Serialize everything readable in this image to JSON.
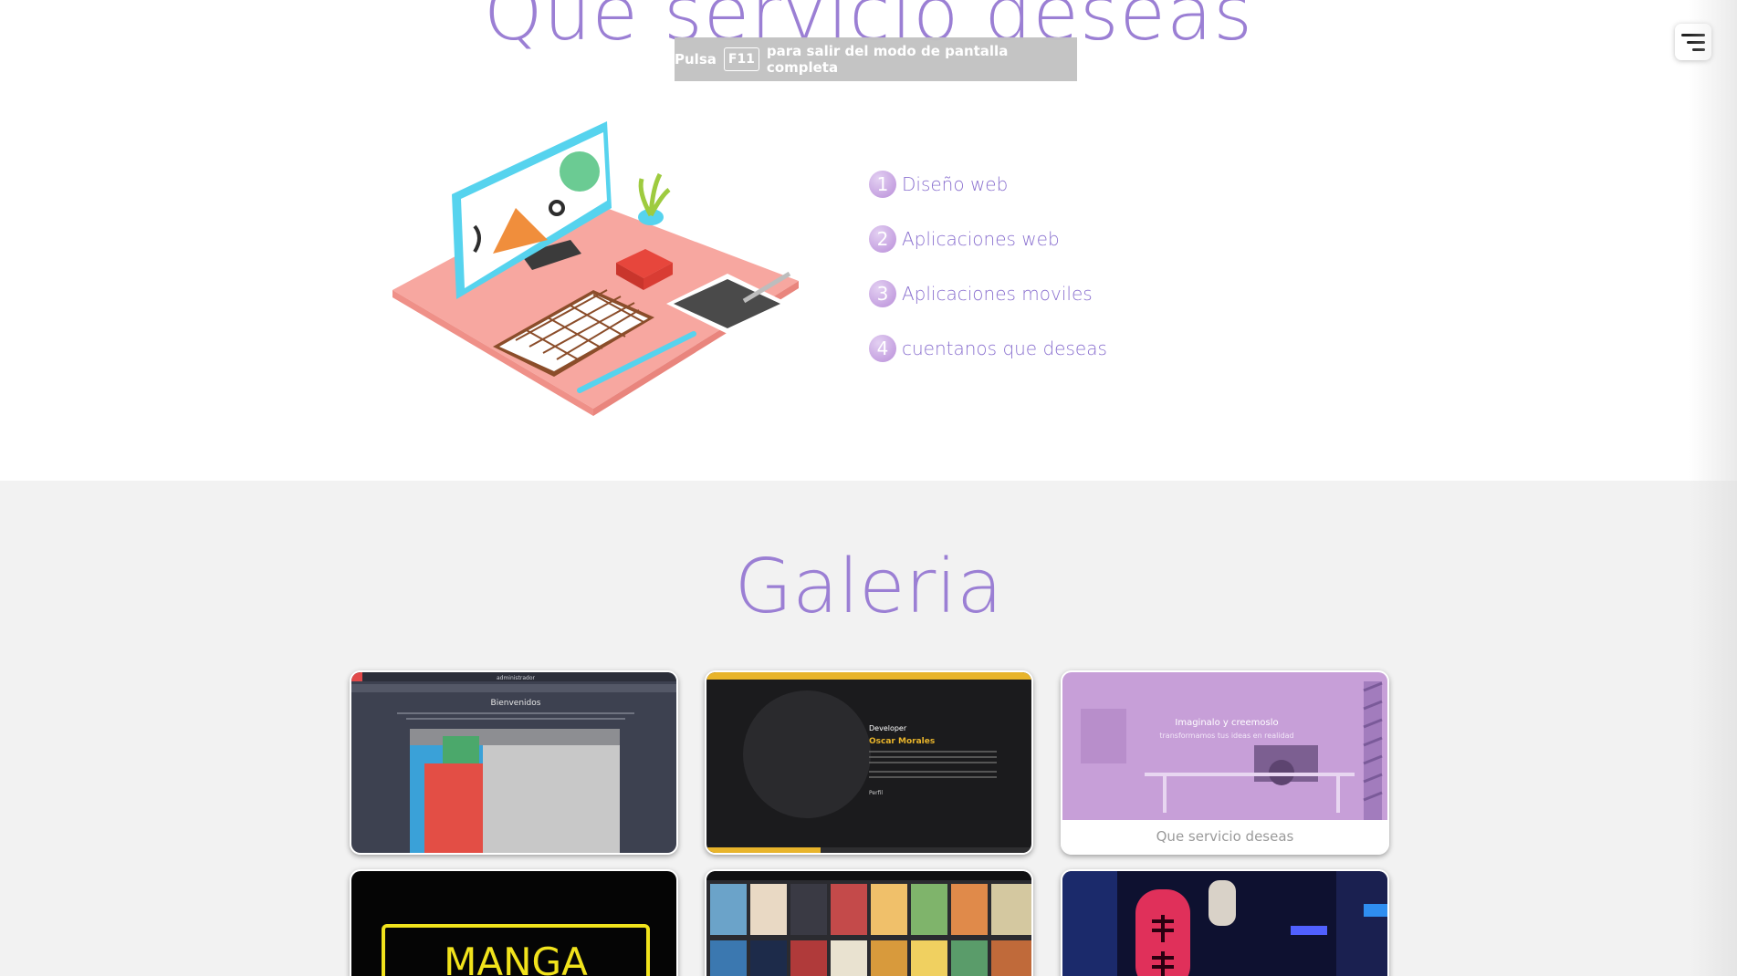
{
  "services": {
    "title": "Que servicio deseas",
    "items": [
      {
        "num": "1",
        "label": "Diseño web"
      },
      {
        "num": "2",
        "label": "Aplicaciones web"
      },
      {
        "num": "3",
        "label": "Aplicaciones moviles"
      },
      {
        "num": "4",
        "label": "cuentanos que deseas"
      }
    ]
  },
  "fullscreen_notice": {
    "before": "Pulsa",
    "key": "F11",
    "after": "para salir del modo de pantalla completa"
  },
  "gallery": {
    "title": "Galeria",
    "cards": [
      {
        "header": "administrador",
        "heading": "Bienvenidos"
      },
      {
        "role": "Developer",
        "name": "Oscar Morales",
        "section": "Perfil"
      },
      {
        "headline": "Imaginalo y creemoslo",
        "subline": "transformamos tus ideas en realidad",
        "caption": "Que servicio deseas"
      },
      {
        "sign": "MANGA"
      },
      {},
      {}
    ]
  },
  "colors": {
    "accent": "#9b7fd4",
    "gallery_bg": "#f2f2f2",
    "notice_bg": "#c2c2c2"
  }
}
